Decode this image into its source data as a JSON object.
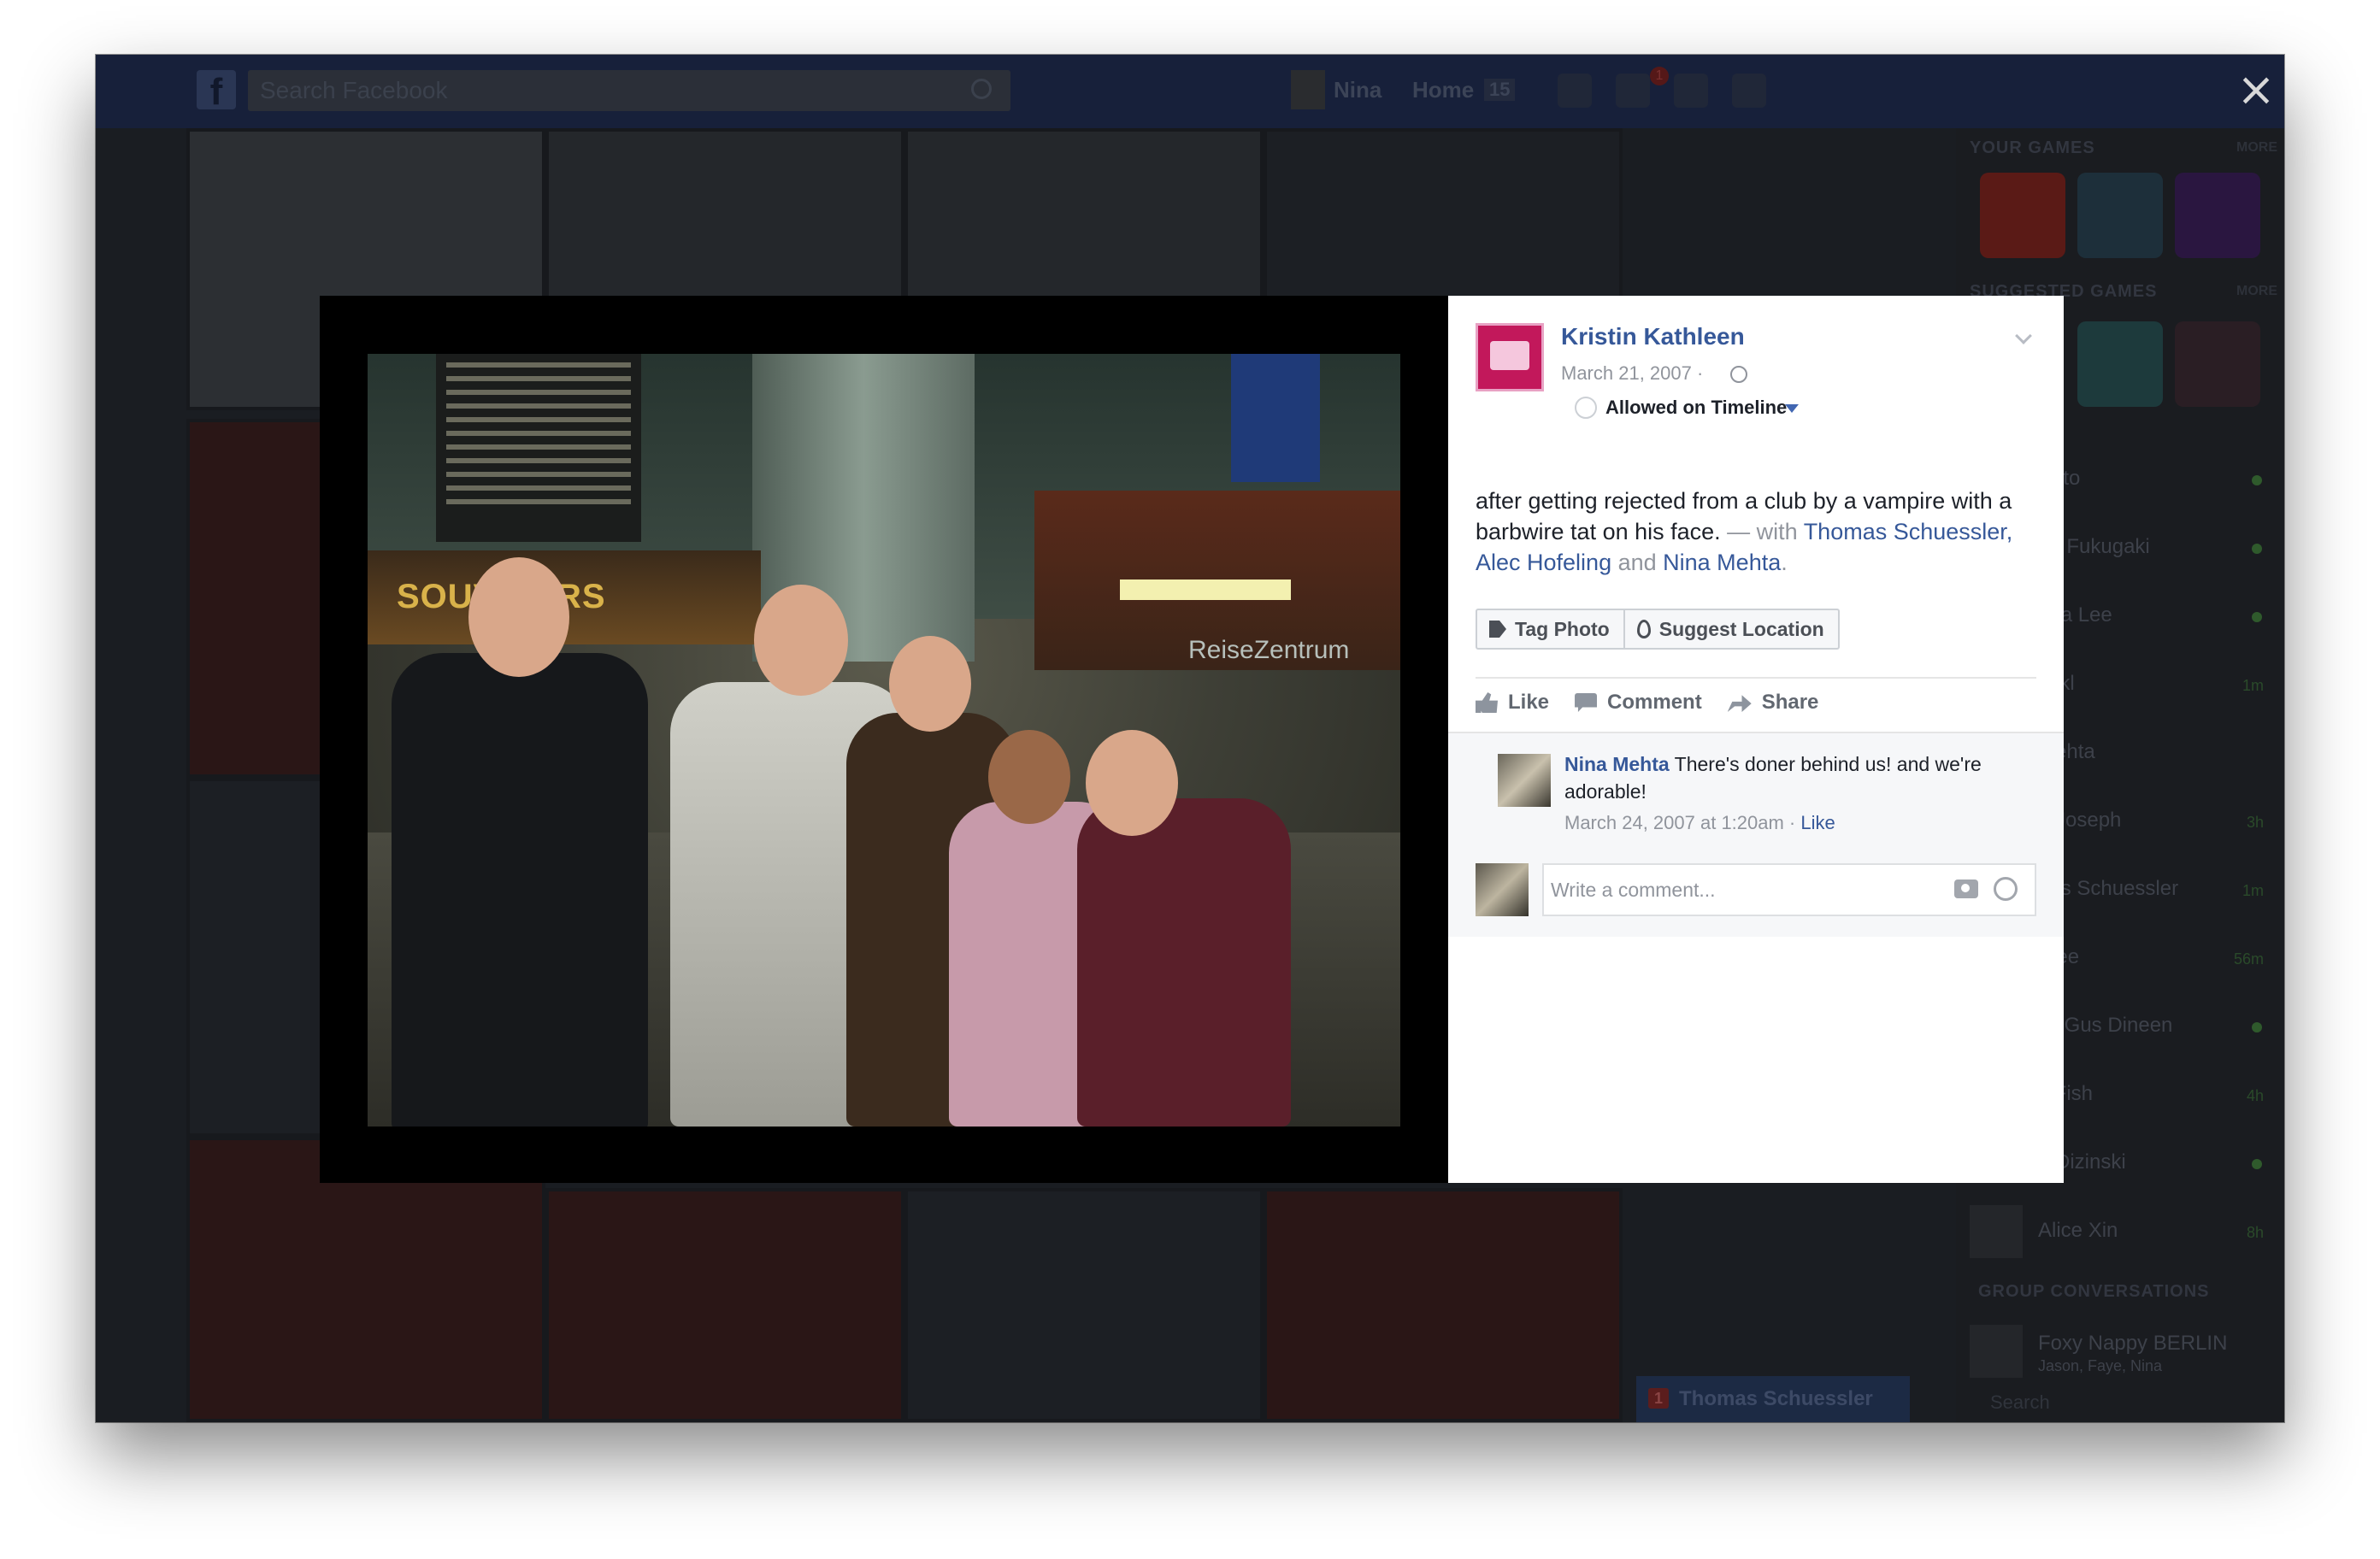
{
  "topbar": {
    "logo": "f",
    "search_placeholder": "Search Facebook",
    "user_name": "Nina",
    "home_label": "Home",
    "home_count": "15",
    "notification_count": "1"
  },
  "sidebar": {
    "your_games_heading": "YOUR GAMES",
    "suggested_games_heading": "SUGGESTED GAMES",
    "more_label": "MORE",
    "contacts": [
      {
        "name": "Sato",
        "status": ""
      },
      {
        "name": "un Fukugaki",
        "status": ""
      },
      {
        "name": "eda Lee",
        "status": ""
      },
      {
        "name": "Jekl",
        "status": "1m"
      },
      {
        "name": "Mehta",
        "status": ""
      },
      {
        "name": "n Joseph",
        "status": "3h"
      },
      {
        "name": "nas Schuessler",
        "status": "1m"
      },
      {
        "name": "Slee",
        "status": "56m"
      },
      {
        "name": "ck Gus Dineen",
        "status": ""
      },
      {
        "name": "s Fish",
        "status": "4h"
      },
      {
        "name": "n Dizinski",
        "status": ""
      },
      {
        "name": "Alice Xin",
        "status": "8h"
      }
    ],
    "group_heading": "GROUP CONVERSATIONS",
    "group_name": "Foxy Nappy BERLIN",
    "group_members": "Jason, Faye, Nina",
    "search_label": "Search"
  },
  "chat_tab": {
    "badge": "1",
    "name": "Thomas Schuessler"
  },
  "photo": {
    "shop_sign": "SOUVENIRS",
    "station_sign": "ReiseZentrum"
  },
  "post": {
    "author": "Kristin Kathleen",
    "date": "March 21, 2007 ·",
    "timeline_label": "Allowed on Timeline",
    "caption_text": "after getting rejected from a club by a vampire with a barbwire tat on his face.",
    "with_prefix": " — with ",
    "tag1": "Thomas Schuessler,",
    "tag2": "Alec Hofeling",
    "and_word": " and ",
    "tag3": "Nina Mehta",
    "period": ".",
    "tag_photo_label": "Tag Photo",
    "suggest_location_label": "Suggest Location",
    "like_label": "Like",
    "comment_label": "Comment",
    "share_label": "Share"
  },
  "comment": {
    "author": "Nina Mehta",
    "text": " There's doner behind us! and we're adorable!",
    "timestamp": "March 24, 2007 at 1:20am · ",
    "like_label": "Like"
  },
  "comment_input": {
    "placeholder": "Write a comment..."
  },
  "close_label": "×"
}
